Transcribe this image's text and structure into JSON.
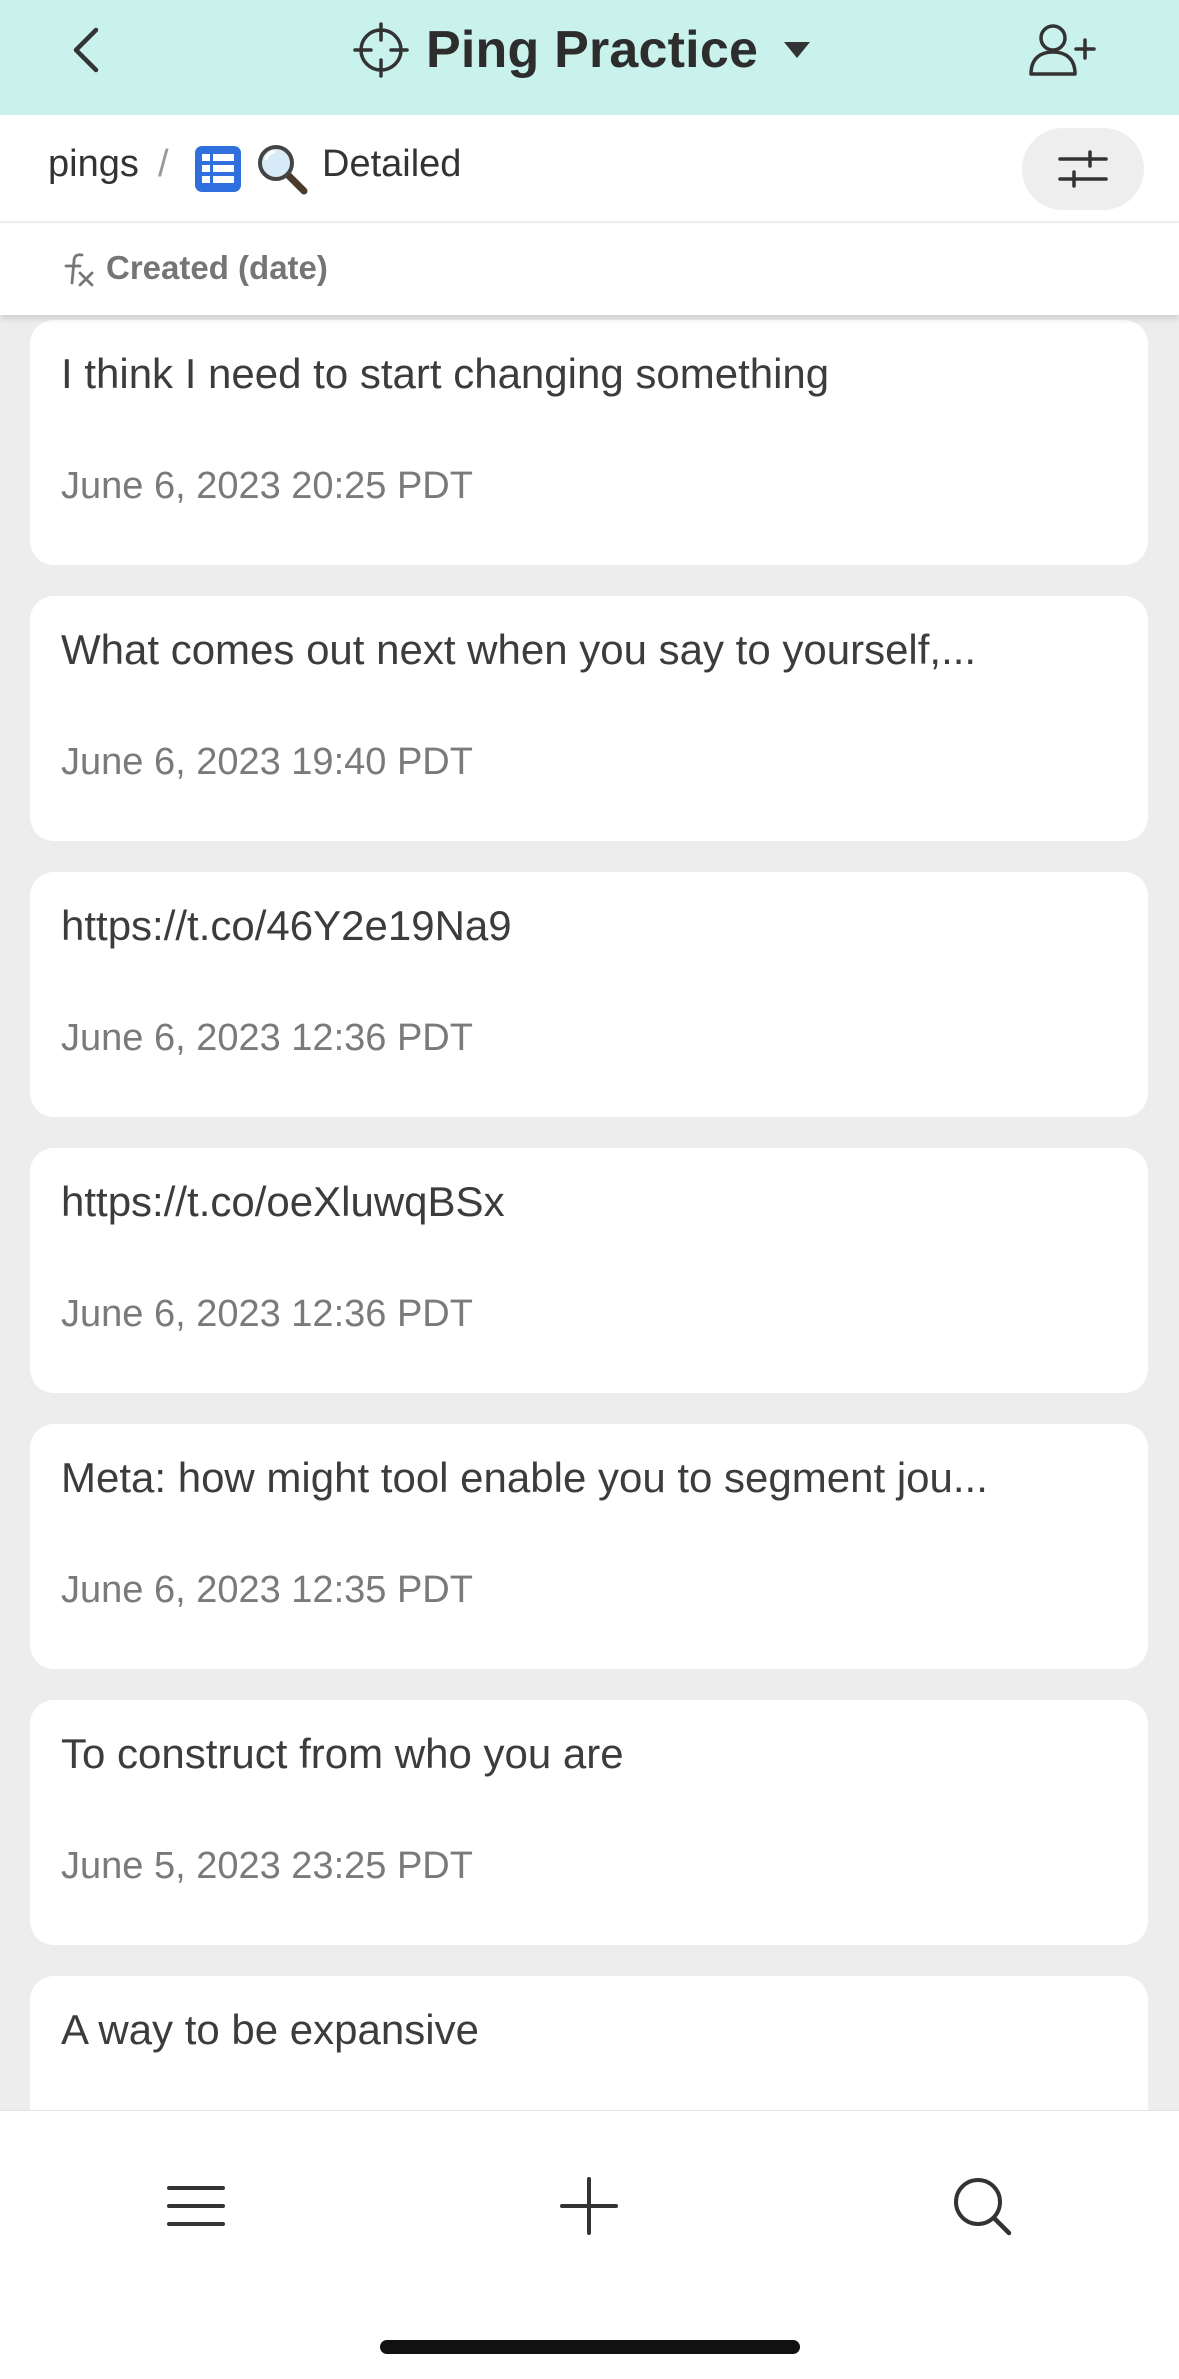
{
  "header": {
    "title": "Ping Practice",
    "back_icon": "chevron-left-icon",
    "title_icon": "crosshair-icon",
    "caret_icon": "caret-down-icon",
    "add_user_icon": "add-user-icon",
    "background_color": "#caf2ec"
  },
  "breadcrumb": {
    "root": "pings",
    "separator": "/",
    "view_icons": [
      "table-grid-icon",
      "magnifier-icon"
    ],
    "view_name": "Detailed",
    "filter_icon": "sliders-icon"
  },
  "sort": {
    "icon": "formula-fx-icon",
    "label": "Created (date)"
  },
  "cards": [
    {
      "title": "I think I need to start changing something",
      "date": "June 6, 2023 20:25 PDT"
    },
    {
      "title": "What comes out next when you say to yourself,...",
      "date": "June 6, 2023 19:40 PDT"
    },
    {
      "title": "https://t.co/46Y2e19Na9",
      "date": "June 6, 2023 12:36 PDT"
    },
    {
      "title": "https://t.co/oeXluwqBSx",
      "date": "June 6, 2023 12:36 PDT"
    },
    {
      "title": "Meta: how might tool enable you to segment jou...",
      "date": "June 6, 2023 12:35 PDT"
    },
    {
      "title": "To construct from who you are",
      "date": "June 5, 2023 23:25 PDT"
    },
    {
      "title": "A way to be expansive",
      "date": ""
    }
  ],
  "bottom_nav": {
    "menu_icon": "hamburger-menu-icon",
    "add_icon": "plus-icon",
    "search_icon": "search-icon"
  }
}
